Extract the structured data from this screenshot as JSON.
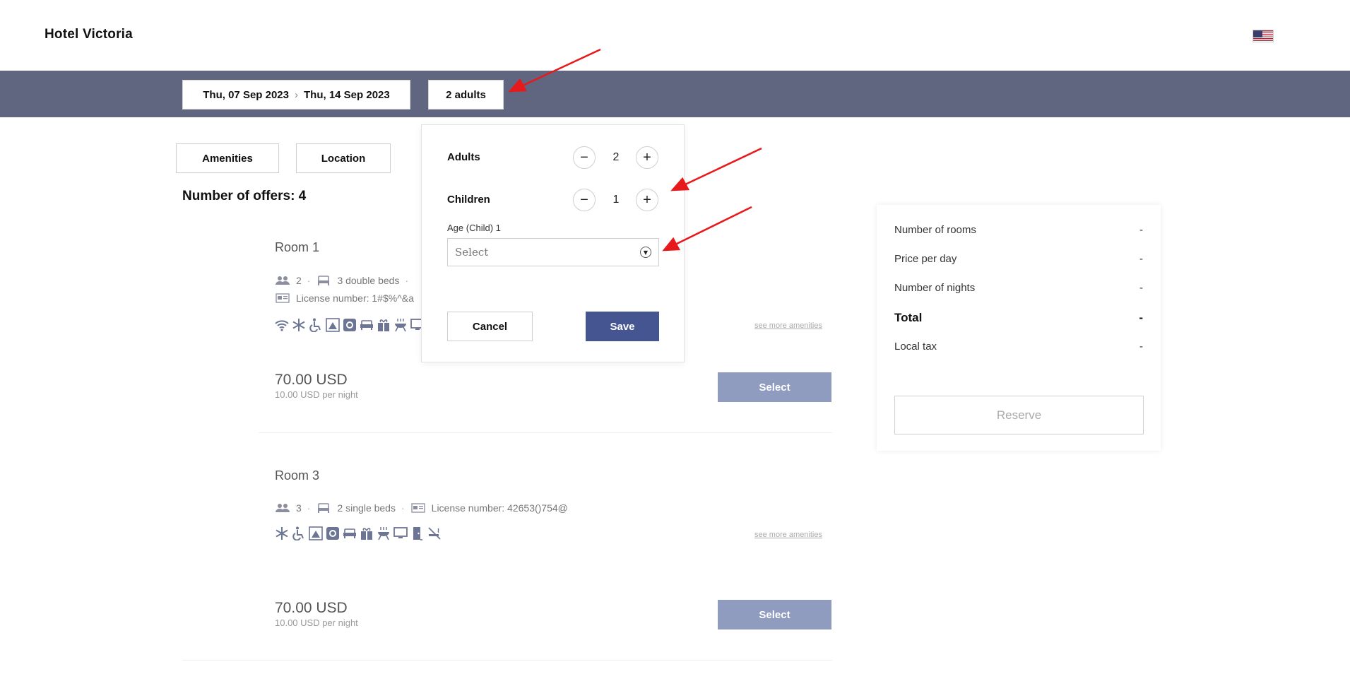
{
  "header": {
    "hotel_name": "Hotel Victoria",
    "flag_icon": "us-flag-icon"
  },
  "search": {
    "check_in": "Thu, 07 Sep 2023",
    "check_out": "Thu, 14 Sep 2023",
    "guests": "2 adults"
  },
  "filters": {
    "amenities": "Amenities",
    "location": "Location"
  },
  "offers": {
    "count_label": "Number of offers: 4"
  },
  "rooms": [
    {
      "title": "Room 1",
      "guests": "2",
      "beds": "3 double beds",
      "license": "License number: 1#$%^&a",
      "see_more": "see more amenities",
      "price": "70.00 USD",
      "per_night": "10.00 USD per night",
      "select": "Select"
    },
    {
      "title": "Room 3",
      "guests": "3",
      "beds": "2 single beds",
      "license": "License number: 42653()754@",
      "see_more": "see more amenities",
      "price": "70.00 USD",
      "per_night": "10.00 USD per night",
      "select": "Select"
    }
  ],
  "summary": {
    "rows": [
      {
        "label": "Number of rooms",
        "value": "-"
      },
      {
        "label": "Price per day",
        "value": "-"
      },
      {
        "label": "Number of nights",
        "value": "-"
      },
      {
        "label": "Total",
        "value": "-"
      },
      {
        "label": "Local tax",
        "value": "-"
      }
    ],
    "reserve": "Reserve"
  },
  "popup": {
    "adults_label": "Adults",
    "adults_value": "2",
    "children_label": "Children",
    "children_value": "1",
    "age_label": "Age (Child) 1",
    "age_placeholder": "Select",
    "cancel": "Cancel",
    "save": "Save",
    "minus": "−",
    "plus": "+"
  },
  "colors": {
    "search_bar": "#616680",
    "primary_button": "#455592",
    "select_button": "#8f9bbf",
    "annotation_arrow": "#e8191b",
    "icon": "#6d7594"
  }
}
